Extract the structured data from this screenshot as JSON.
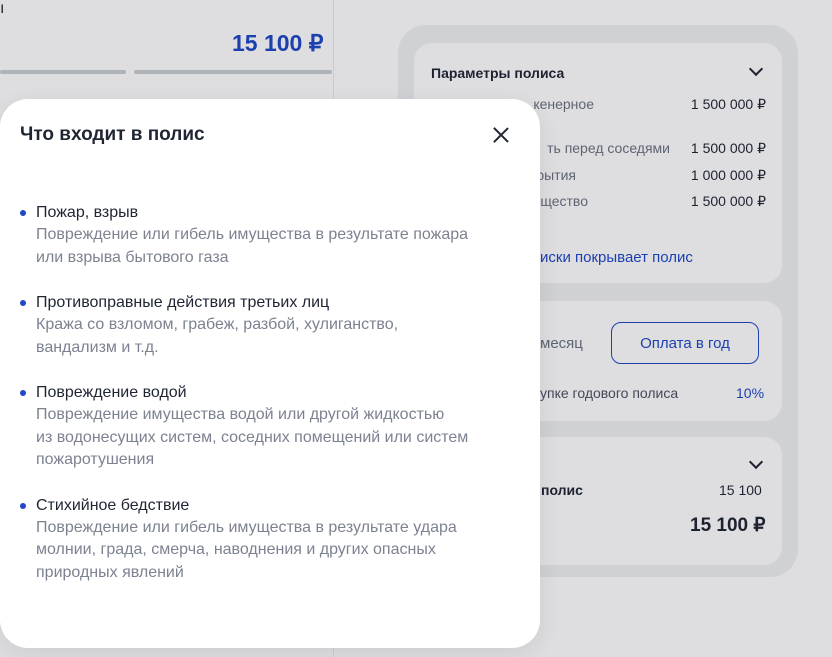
{
  "background": {
    "fragment_title": "ı",
    "price": "15 100 ₽",
    "params": {
      "title": "Параметры полиса",
      "rows": [
        {
          "label": "кенерное",
          "value": "1 500 000 ₽"
        },
        {
          "label": "ть перед соседями",
          "value": "1 500 000 ₽"
        },
        {
          "label": "рытия",
          "value": "1 000 000 ₽"
        },
        {
          "label": "щество",
          "value": "1 500 000 ₽"
        }
      ],
      "covers_link": "иски покрывает полис"
    },
    "payment": {
      "month_label": "месяц",
      "year_label": "Оплата в год",
      "discount_note": "упке годового полиса",
      "discount_value": "10%"
    },
    "summary": {
      "label": "полис",
      "value": "15 100",
      "total": "15 100 ₽"
    }
  },
  "modal": {
    "title": "Что входит в полис",
    "items": [
      {
        "title": "Пожар, взрыв",
        "description_lines": [
          "Повреждение или гибель имущества в результате пожара",
          "или взрыва бытового газа"
        ]
      },
      {
        "title": "Противоправные действия третьих лиц",
        "description_lines": [
          "Кража со взломом, грабеж, разбой, хулиганство,",
          "вандализм и т.д."
        ]
      },
      {
        "title": "Повреждение водой",
        "description_lines": [
          "Повреждение имущества водой или другой жидкостью",
          "из водонесущих систем, соседних помещений или систем",
          "пожаротушения"
        ]
      },
      {
        "title": "Стихийное бедствие",
        "description_lines": [
          "Повреждение или гибель имущества в результате удара",
          "молнии, града, смерча, наводнения и других опасных",
          "природных явлений"
        ]
      }
    ],
    "close_icon": "close-icon",
    "colors": {
      "accent": "#1f47c7",
      "title": "#1f2533",
      "description": "#7c8290",
      "overlay": "rgba(20,24,36,0.14)"
    }
  }
}
